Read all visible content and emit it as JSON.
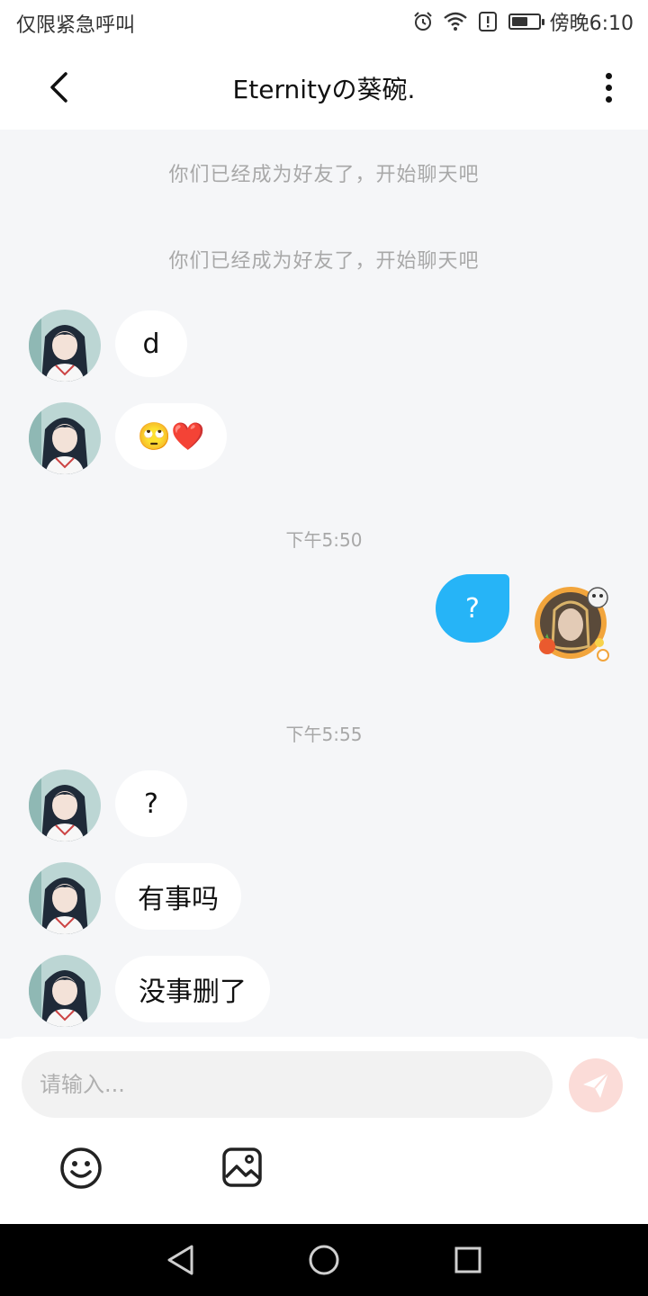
{
  "status_bar": {
    "left_text": "仅限紧急呼叫",
    "time": "傍晚6:10",
    "icons": [
      "alarm-icon",
      "wifi-icon",
      "alert-icon",
      "battery-icon"
    ]
  },
  "header": {
    "title": "Eternityの葵碗.",
    "back_icon": "chevron-left-icon",
    "more_icon": "more-vertical-icon"
  },
  "chat": {
    "system_messages": [
      "你们已经成为好友了，开始聊天吧",
      "你们已经成为好友了，开始聊天吧"
    ],
    "timestamps": [
      "下午5:50",
      "下午5:55"
    ],
    "messages": [
      {
        "direction": "in",
        "text": "d"
      },
      {
        "direction": "in",
        "text": "🙄❤️"
      },
      {
        "direction": "out",
        "text": "?"
      },
      {
        "direction": "in",
        "text": "?"
      },
      {
        "direction": "in",
        "text": "有事吗"
      },
      {
        "direction": "in",
        "text": "没事删了"
      }
    ]
  },
  "input": {
    "placeholder": "请输入...",
    "send_icon": "send-icon",
    "emoji_icon": "smiley-icon",
    "image_icon": "image-icon"
  },
  "colors": {
    "outgoing_bubble": "#26b4f7",
    "chat_background": "#f5f6f8",
    "send_button": "#fbdcd8"
  }
}
